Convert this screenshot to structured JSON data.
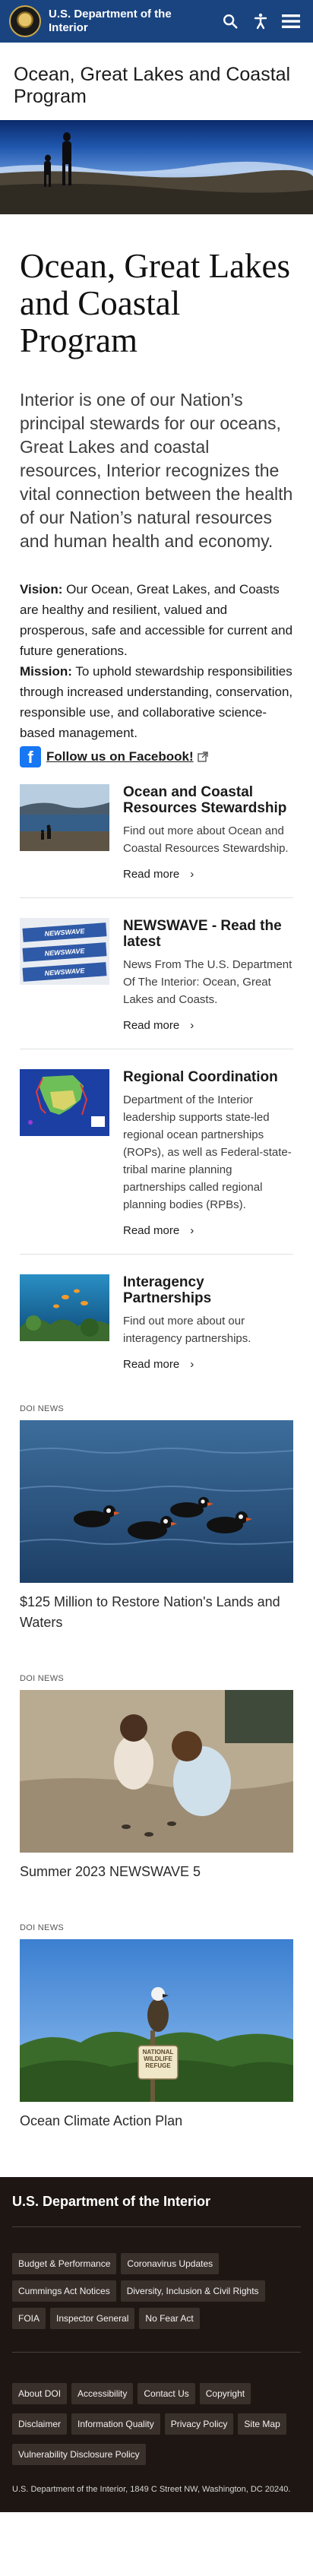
{
  "header": {
    "site_name_line1": "U.S. Department of the",
    "site_name_line2": "Interior",
    "icons": [
      "seal-logo",
      "search-icon",
      "accessibility-icon",
      "menu-icon"
    ]
  },
  "page": {
    "subtitle": "Ocean, Great Lakes and Coastal Program",
    "title": "Ocean, Great Lakes and Coastal Program",
    "lead": "Interior is one of our Nation’s principal stewards for our oceans, Great Lakes and coastal resources, Interior recognizes the vital connection between the health of our Nation’s natural resources and human health and economy.",
    "vision_label": "Vision:",
    "vision_text": " Our Ocean, Great Lakes, and Coasts are healthy and resilient, valued and prosperous, safe and accessible for current and future generations.",
    "mission_label": "Mission:",
    "mission_text": " To uphold stewardship responsibilities through increased understanding, conservation, responsible use, and collaborative science-based management.",
    "facebook_label": "Follow us on Facebook!"
  },
  "cards": [
    {
      "title": "Ocean and Coastal Resources Stewardship",
      "text": "Find out more about Ocean and Coastal Resources Stewardship.",
      "readmore": "Read more"
    },
    {
      "title": "NEWSWAVE - Read the latest",
      "text": "News From The U.S. Department Of The Interior: Ocean, Great Lakes and Coasts.",
      "readmore": "Read more",
      "image_text": "NEWSWAVE"
    },
    {
      "title": "Regional Coordination",
      "text": "Department of the Interior leadership supports state-led regional ocean partnerships (ROPs), as well as Federal-state-tribal marine planning partnerships called regional planning bodies (RPBs).",
      "readmore": "Read more"
    },
    {
      "title": "Interagency Partnerships",
      "text": "Find out more about our interagency partnerships.",
      "readmore": "Read more"
    }
  ],
  "news": [
    {
      "tag": "DOI News",
      "title": "$125 Million to Restore Nation's Lands and Waters"
    },
    {
      "tag": "DOI News",
      "title": "Summer 2023 NEWSWAVE 5"
    },
    {
      "tag": "DOI News",
      "title": "Ocean Climate Action Plan",
      "sign_text": "NATIONAL WILDLIFE REFUGE"
    }
  ],
  "footer": {
    "title": "U.S. Department of the Interior",
    "group1": [
      "Budget & Performance",
      "Coronavirus Updates",
      "Cummings Act Notices",
      "Diversity, Inclusion & Civil Rights",
      "FOIA",
      "Inspector General",
      "No Fear Act"
    ],
    "group2": [
      "About DOI",
      "Accessibility",
      "Contact Us",
      "Copyright",
      "Disclaimer",
      "Information Quality",
      "Privacy Policy",
      "Site Map",
      "Vulnerability Disclosure Policy"
    ],
    "address": "U.S. Department of the Interior, 1849 C Street NW, Washington, DC 20240."
  },
  "colors": {
    "header_bg": "#1a4480",
    "footer_bg": "#1e1612",
    "footer_button_bg": "#3a302b",
    "facebook_blue": "#1877f2"
  }
}
